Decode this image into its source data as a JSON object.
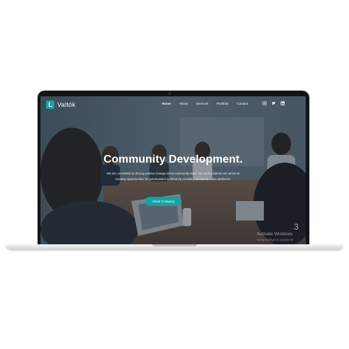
{
  "brand": {
    "name": "Valtók",
    "mark": "L"
  },
  "nav": {
    "items": [
      {
        "label": "Home",
        "active": true
      },
      {
        "label": "About",
        "active": false
      },
      {
        "label": "Services",
        "active": false
      },
      {
        "label": "Portfolio",
        "active": false
      },
      {
        "label": "Contact",
        "active": false
      }
    ],
    "social_icons": [
      "instagram-icon",
      "twitter-icon",
      "linkedin-icon"
    ]
  },
  "hero": {
    "title": "Community Development.",
    "text": "We are committed to driving positive change at the community level. Our tech solutions are aimed at creating opportunities for communities in Africa by providing access to online platforms.",
    "button_label": "About Company"
  },
  "watermark": {
    "line1": "Activate Windows",
    "line2": "Go to Settings to activate W",
    "number": "3"
  },
  "colors": {
    "accent": "#16a3a6",
    "overlay": "#182634"
  }
}
